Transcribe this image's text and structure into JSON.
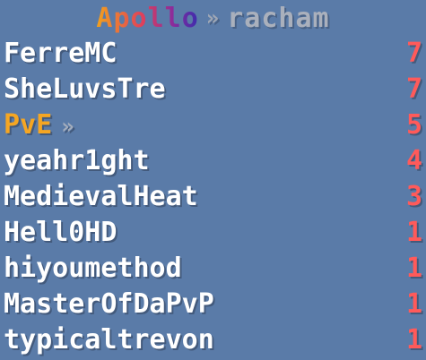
{
  "header": {
    "brand": "Apollo",
    "separator": "»",
    "server": "racham"
  },
  "colors": {
    "background": "#5a7ba8",
    "name": "#ffffff",
    "highlight": "#f5a623",
    "score": "#ff5a5a"
  },
  "rows": [
    {
      "name": "FerreMC",
      "score": "7"
    },
    {
      "name": "SheLuvsTre",
      "score": "7"
    },
    {
      "name": "PvE",
      "suffix": "»",
      "score": "5"
    },
    {
      "name": "yeahr1ght",
      "score": "4"
    },
    {
      "name": "MedievalHeat",
      "score": "3"
    },
    {
      "name": "Hell0HD",
      "score": "1"
    },
    {
      "name": "hiyoumethod",
      "score": "1"
    },
    {
      "name": "MasterOfDaPvP",
      "score": "1"
    },
    {
      "name": "typicaltrevon",
      "score": "1"
    }
  ]
}
